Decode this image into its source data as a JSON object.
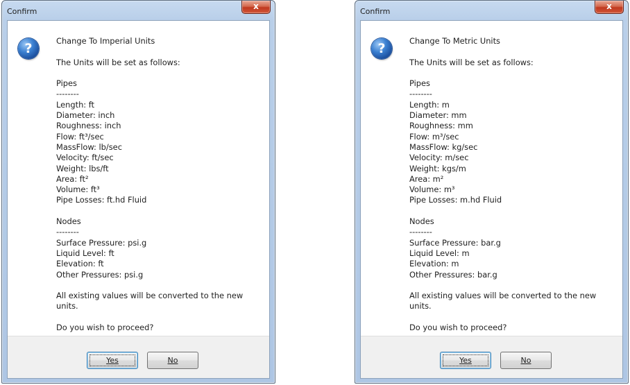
{
  "dialogs": [
    {
      "title": "Confirm",
      "close_glyph": "x",
      "icon": "question-icon",
      "icon_glyph": "?",
      "heading": "Change To Imperial Units",
      "intro": "The Units will be set as follows:",
      "pipes": {
        "header": "Pipes",
        "separator": "--------",
        "lines": [
          "Length: ft",
          "Diameter: inch",
          "Roughness: inch",
          "Flow: ft³/sec",
          "MassFlow: lb/sec",
          "Velocity: ft/sec",
          "Weight: lbs/ft",
          "Area: ft²",
          "Volume: ft³",
          "Pipe Losses: ft.hd Fluid"
        ]
      },
      "nodes": {
        "header": "Nodes",
        "separator": "--------",
        "lines": [
          "Surface Pressure: psi.g",
          "Liquid Level: ft",
          "Elevation: ft",
          "Other Pressures: psi.g"
        ]
      },
      "conversion_note": "All existing values will be converted to the new units.",
      "prompt": "Do you wish to proceed?",
      "yes_label": "Yes",
      "no_label": "No"
    },
    {
      "title": "Confirm",
      "close_glyph": "x",
      "icon": "question-icon",
      "icon_glyph": "?",
      "heading": "Change To Metric Units",
      "intro": "The Units will be set as follows:",
      "pipes": {
        "header": "Pipes",
        "separator": "--------",
        "lines": [
          "Length: m",
          "Diameter: mm",
          "Roughness: mm",
          "Flow: m³/sec",
          "MassFlow: kg/sec",
          "Velocity: m/sec",
          "Weight: kgs/m",
          "Area: m²",
          "Volume: m³",
          "Pipe Losses: m.hd Fluid"
        ]
      },
      "nodes": {
        "header": "Nodes",
        "separator": "--------",
        "lines": [
          "Surface Pressure: bar.g",
          "Liquid Level: m",
          "Elevation: m",
          "Other Pressures: bar.g"
        ]
      },
      "conversion_note": "All existing values will be converted to the new units.",
      "prompt": "Do you wish to proceed?",
      "yes_label": "Yes",
      "no_label": "No"
    }
  ],
  "colors": {
    "frame": "#b9cfe9",
    "close_button": "#c7432a",
    "question_icon": "#2a66b8",
    "text": "#1e1e1e"
  }
}
